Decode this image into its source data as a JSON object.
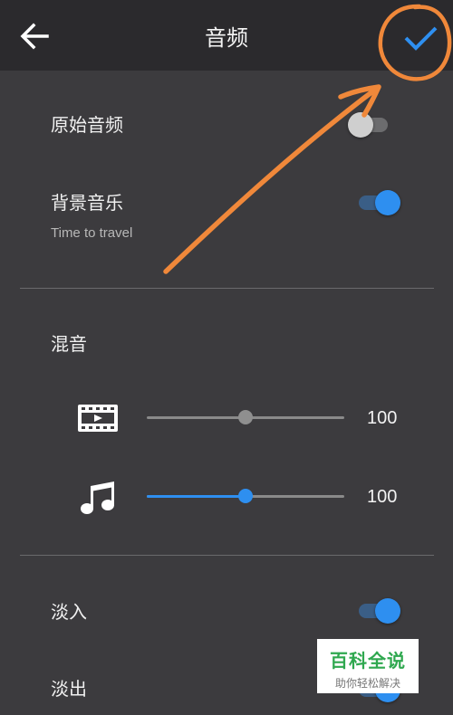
{
  "header": {
    "title": "音频",
    "back_icon": "arrow-left-icon",
    "confirm_icon": "checkmark-icon"
  },
  "original_audio": {
    "label": "原始音频",
    "enabled": false
  },
  "background_music": {
    "label": "背景音乐",
    "track": "Time to travel",
    "enabled": true
  },
  "mix": {
    "title": "混音",
    "video_volume": {
      "icon": "film-icon",
      "value": "100",
      "level": 0.5
    },
    "music_volume": {
      "icon": "music-note-icon",
      "value": "100",
      "level": 0.5
    }
  },
  "fade_in": {
    "label": "淡入",
    "enabled": true
  },
  "fade_out": {
    "label": "淡出",
    "enabled": true
  },
  "watermark": {
    "title": "百科全说",
    "subtitle": "助你轻松解决"
  },
  "colors": {
    "accent": "#2e8ff0",
    "annotation": "#f0883a",
    "background": "#3c3b3e",
    "toolbar": "#2b2a2d"
  }
}
